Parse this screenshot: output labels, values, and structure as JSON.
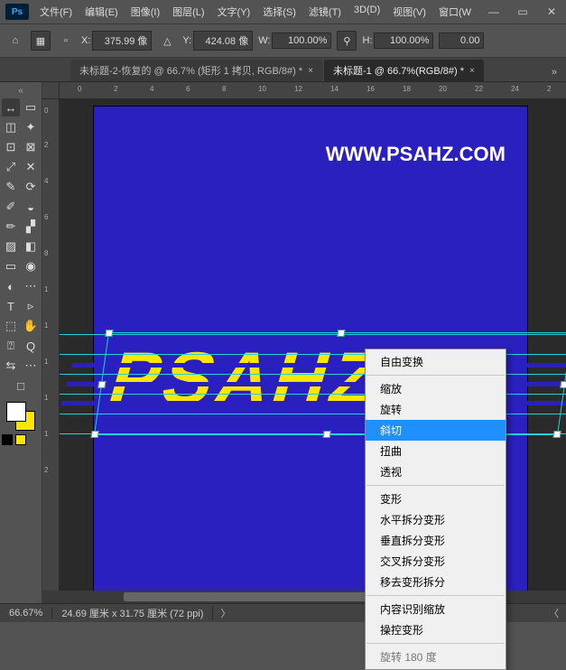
{
  "app": {
    "ps_label": "Ps"
  },
  "menu": {
    "items": [
      "文件(F)",
      "编辑(E)",
      "图像(I)",
      "图层(L)",
      "文字(Y)",
      "选择(S)",
      "滤镜(T)",
      "3D(D)",
      "视图(V)",
      "窗口(W"
    ]
  },
  "winbtns": {
    "min": "—",
    "max": "▭",
    "close": "✕"
  },
  "options": {
    "x_label": "X:",
    "x_value": "375.99 像",
    "y_label": "Y:",
    "y_value": "424.08 像",
    "w_label": "W:",
    "w_value": "100.00%",
    "h_label": "H:",
    "h_value": "100.00%",
    "rot_value": "0.00"
  },
  "tabs": {
    "items": [
      {
        "label": "未标题-2-恢复的 @ 66.7% (矩形 1 拷贝, RGB/8#) *",
        "active": false
      },
      {
        "label": "未标题-1 @ 66.7%(RGB/8#) *",
        "active": true
      }
    ],
    "chev": "»"
  },
  "tool_icons": [
    [
      "↔",
      "▭"
    ],
    [
      "◫",
      "✦"
    ],
    [
      "⊡",
      "⊠"
    ],
    [
      "⤢",
      "✕"
    ],
    [
      "✎",
      "⟳"
    ],
    [
      "✐",
      "◒"
    ],
    [
      "✏",
      "▞"
    ],
    [
      "▨",
      "◧"
    ],
    [
      "▭",
      "◉"
    ],
    [
      "◐",
      "⋯"
    ],
    [
      "T",
      "▹"
    ],
    [
      "⬚",
      "✋"
    ],
    [
      "⍰",
      "Q"
    ],
    [
      "⇆",
      "⋯"
    ],
    [
      "□",
      ""
    ]
  ],
  "swatch": {
    "fg": "#ffffff",
    "bg": "#ffe600"
  },
  "ruler_h": [
    "0",
    "2",
    "4",
    "6",
    "8",
    "10",
    "12",
    "14",
    "16",
    "18",
    "20",
    "22",
    "24",
    "2"
  ],
  "ruler_v": [
    "0",
    "2",
    "4",
    "6",
    "8",
    "1",
    "1",
    "1",
    "1",
    "1",
    "2"
  ],
  "canvas": {
    "watermark": "WWW.PSAHZ.COM",
    "logo_text": "PSAHZ"
  },
  "context_menu": {
    "groups": [
      [
        "自由变换"
      ],
      [
        "缩放",
        "旋转",
        "斜切",
        "扭曲",
        "透视"
      ],
      [
        "变形",
        "水平拆分变形",
        "垂直拆分变形",
        "交叉拆分变形",
        "移去变形拆分"
      ],
      [
        "内容识别缩放",
        "操控变形"
      ],
      [
        "旋转 180 度"
      ]
    ],
    "highlighted": "斜切",
    "last_cut": true
  },
  "status": {
    "zoom": "66.67%",
    "doc": "24.69 厘米 x 31.75 厘米 (72 ppi)",
    "chev": "〉",
    "end": "〈"
  },
  "chart_data": null
}
